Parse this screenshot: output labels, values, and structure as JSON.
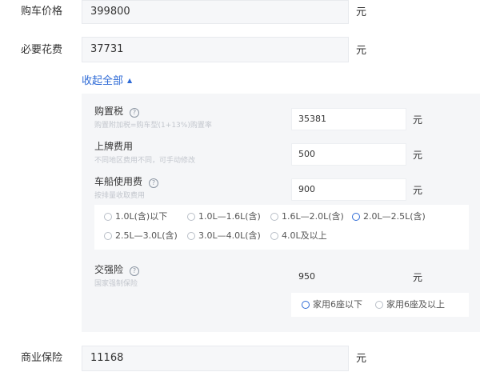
{
  "purchase_price": {
    "label": "购车价格",
    "value": "399800",
    "unit": "元"
  },
  "required_costs": {
    "label": "必要花费",
    "value": "37731",
    "unit": "元"
  },
  "collapse": {
    "label": "收起全部",
    "caret": "▲"
  },
  "purchase_tax": {
    "title": "购置税",
    "help": "?",
    "desc": "购置附加税=购车型(1+13%)购置率",
    "value": "35381",
    "unit": "元"
  },
  "registration_fee": {
    "title": "上牌费用",
    "desc": "不同地区费用不同，可手动修改",
    "value": "500",
    "unit": "元"
  },
  "vehicle_tax": {
    "title": "车船使用费",
    "help": "?",
    "desc": "按排量收取费用",
    "value": "900",
    "unit": "元",
    "options": [
      {
        "label": "1.0L(含)以下",
        "selected": false
      },
      {
        "label": "1.0L—1.6L(含)",
        "selected": false
      },
      {
        "label": "1.6L—2.0L(含)",
        "selected": false
      },
      {
        "label": "2.0L—2.5L(含)",
        "selected": true
      },
      {
        "label": "2.5L—3.0L(含)",
        "selected": false
      },
      {
        "label": "3.0L—4.0L(含)",
        "selected": false
      },
      {
        "label": "4.0L及以上",
        "selected": false
      }
    ]
  },
  "compulsory_insurance": {
    "title": "交强险",
    "help": "?",
    "desc": "国家强制保险",
    "value": "950",
    "unit": "元",
    "options": [
      {
        "label": "家用6座以下",
        "selected": true
      },
      {
        "label": "家用6座及以上",
        "selected": false
      }
    ]
  },
  "commercial_insurance": {
    "label": "商业保险",
    "value": "11168",
    "unit": "元"
  },
  "colors": {
    "accent": "#2f6bd6",
    "panel": "#f5f6f8",
    "input": "#f6f7f9"
  }
}
